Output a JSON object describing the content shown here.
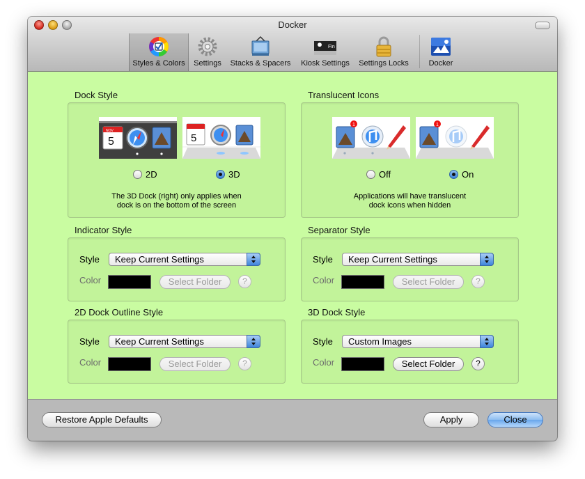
{
  "window": {
    "title": "Docker"
  },
  "toolbar": {
    "items": [
      {
        "label": "Styles & Colors",
        "icon": "color-wheel-icon",
        "selected": true
      },
      {
        "label": "Settings",
        "icon": "gear-icon",
        "selected": false
      },
      {
        "label": "Stacks & Spacers",
        "icon": "stacks-icon",
        "selected": false
      },
      {
        "label": "Kiosk Settings",
        "icon": "kiosk-icon",
        "selected": false,
        "icon_text": "Fin"
      },
      {
        "label": "Settings Locks",
        "icon": "lock-icon",
        "selected": false
      },
      {
        "label": "Docker",
        "icon": "docker-app-icon",
        "selected": false
      }
    ]
  },
  "dock_style": {
    "title": "Dock Style",
    "options": [
      {
        "label": "2D",
        "selected": false
      },
      {
        "label": "3D",
        "selected": true
      }
    ],
    "note_line1": "The 3D Dock (right) only applies when",
    "note_line2": "dock is on the bottom of the screen",
    "calendar_day": "5",
    "calendar_month": "NOV"
  },
  "translucent_icons": {
    "title": "Translucent Icons",
    "options": [
      {
        "label": "Off",
        "selected": false
      },
      {
        "label": "On",
        "selected": true
      }
    ],
    "note_line1": "Applications will have translucent",
    "note_line2": "dock icons when hidden",
    "badge": "1"
  },
  "indicator_style": {
    "title": "Indicator Style",
    "style_label": "Style",
    "style_value": "Keep Current Settings",
    "color_label": "Color",
    "folder_button": "Select Folder",
    "help": "?",
    "enabled": false
  },
  "separator_style": {
    "title": "Separator Style",
    "style_label": "Style",
    "style_value": "Keep Current Settings",
    "color_label": "Color",
    "folder_button": "Select Folder",
    "help": "?",
    "enabled": false
  },
  "outline_style": {
    "title": "2D Dock Outline Style",
    "style_label": "Style",
    "style_value": "Keep Current Settings",
    "color_label": "Color",
    "folder_button": "Select Folder",
    "help": "?",
    "enabled": false
  },
  "dock3d_style": {
    "title": "3D Dock Style",
    "style_label": "Style",
    "style_value": "Custom Images",
    "color_label": "Color",
    "folder_button": "Select Folder",
    "help": "?",
    "enabled": true
  },
  "footer": {
    "restore": "Restore Apple Defaults",
    "apply": "Apply",
    "close": "Close"
  },
  "colors": {
    "content_bg": "#c9fca1",
    "swatch": "#000000",
    "default_button": "#68a6ec"
  }
}
